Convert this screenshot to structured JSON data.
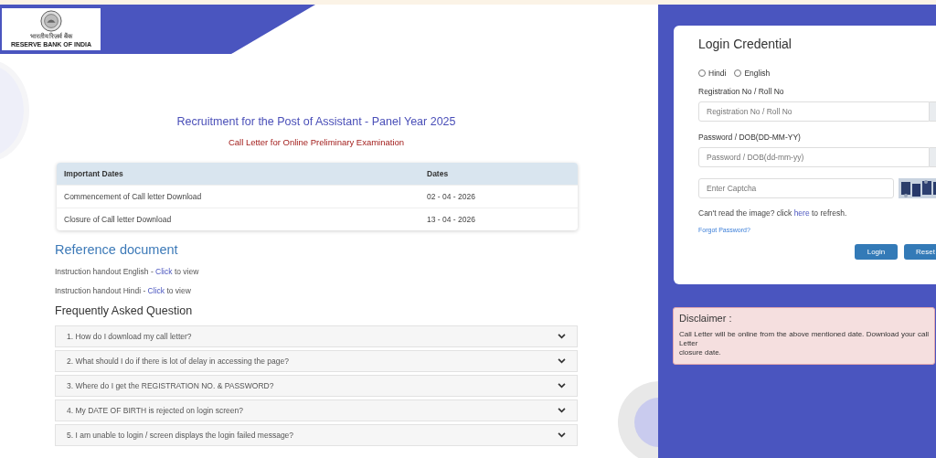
{
  "logo": {
    "hindi": "भारतीय रिज़र्व बैंक",
    "english": "RESERVE BANK OF INDIA"
  },
  "title": "Recruitment for the Post of Assistant - Panel Year 2025",
  "subtitle": "Call Letter for Online Preliminary Examination",
  "table": {
    "columns": [
      "Important Dates",
      "Dates"
    ],
    "rows": [
      [
        "Commencement of Call letter Download",
        "02 - 04 - 2026"
      ],
      [
        "Closure of Call letter Download",
        "13 - 04 - 2026"
      ]
    ]
  },
  "reference": {
    "heading": "Reference document",
    "items": [
      {
        "before": "Instruction handout English - ",
        "link": "Click",
        "after": " to view"
      },
      {
        "before": "Instruction handout Hindi - ",
        "link": "Click",
        "after": " to view"
      }
    ]
  },
  "faq": {
    "heading": "Frequently Asked Question",
    "items": [
      {
        "question": "1. How do I download my call letter?",
        "expanded": false
      },
      {
        "question": "2. What should I do if there is lot of delay in accessing the page?",
        "expanded": false
      },
      {
        "question": "3. Where do I get the REGISTRATION NO. & PASSWORD?",
        "expanded": false
      },
      {
        "question": "4. My DATE OF BIRTH is rejected on login screen?",
        "expanded": false
      },
      {
        "question": "5. I am unable to login / screen displays the login failed message?",
        "expanded": false
      }
    ]
  },
  "login": {
    "title": "Login Credential",
    "languages": [
      {
        "label": "Hindi",
        "selected": false
      },
      {
        "label": "English",
        "selected": false
      }
    ],
    "fields": [
      {
        "label": "Registration No / Roll No",
        "placeholder": "Registration No / Roll No"
      },
      {
        "label": "Password / DOB(DD-MM-YY)",
        "placeholder": "Password / DOB(dd-mm-yy)"
      }
    ],
    "captcha": {
      "placeholder": "Enter Captcha"
    },
    "refresh": {
      "before": "Can't read the image? click ",
      "link": "here",
      "after": " to refresh."
    },
    "forgot": "Forgot Password?",
    "buttons": [
      "Login",
      "Reset"
    ]
  },
  "disclaimer": {
    "title": "Disclaimer :",
    "lines": [
      "Call Letter will be online from the above mentioned date. Download your call Letter",
      "closure date."
    ]
  }
}
